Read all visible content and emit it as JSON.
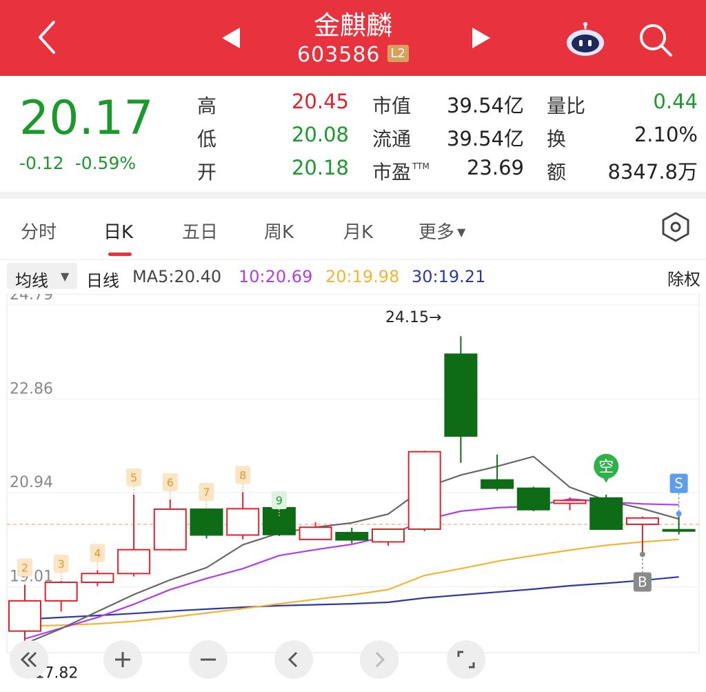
{
  "header": {
    "title": "金麒麟",
    "code": "603586",
    "level_badge": "L2",
    "bg_color": "#e8323e"
  },
  "quote": {
    "price": "20.17",
    "change": "-0.12",
    "change_pct": "-0.59%",
    "fields": [
      {
        "label": "高",
        "value": "20.45",
        "color": "red"
      },
      {
        "label": "低",
        "value": "20.08",
        "color": "green"
      },
      {
        "label": "开",
        "value": "20.18",
        "color": "green"
      },
      {
        "label": "市值",
        "value": "39.54亿",
        "color": "dark"
      },
      {
        "label": "流通",
        "value": "39.54亿",
        "color": "dark"
      },
      {
        "label": "市盈",
        "label_sup": "TTM",
        "value": "23.69",
        "color": "dark"
      },
      {
        "label": "量比",
        "value": "0.44",
        "color": "green"
      },
      {
        "label": "换",
        "value": "2.10%",
        "color": "dark"
      },
      {
        "label": "额",
        "value": "8347.8万",
        "color": "dark"
      }
    ]
  },
  "tabs": [
    "分时",
    "日K",
    "五日",
    "周K",
    "月K",
    "更多"
  ],
  "active_tab": "日K",
  "ma_bar": {
    "selector": "均线",
    "line_type": "日线",
    "ma5": "MA5:20.40",
    "ma10": "10:20.69",
    "ma20": "20:19.98",
    "ma30": "30:19.21",
    "adjust": "除权",
    "colors": {
      "ma5": "#666666",
      "ma10": "#b03cf0",
      "ma20": "#f3b431",
      "ma30": "#2e37a8"
    }
  },
  "chart_data": {
    "type": "candlestick",
    "y_ticks": [
      "24.79",
      "22.86",
      "20.94",
      "19.01"
    ],
    "y_tick_values": [
      24.79,
      22.86,
      20.94,
      19.01
    ],
    "high_label": "24.15→",
    "low_label": "←17.82",
    "up_color": "#e4202a",
    "down_color": "#0e6b16",
    "reference_price": 20.29,
    "candles": [
      {
        "o": 18.1,
        "h": 19.05,
        "l": 17.82,
        "c": 18.72
      },
      {
        "o": 18.72,
        "h": 19.13,
        "l": 18.5,
        "c": 19.1
      },
      {
        "o": 19.1,
        "h": 19.35,
        "l": 19.02,
        "c": 19.28
      },
      {
        "o": 19.28,
        "h": 20.9,
        "l": 19.22,
        "c": 19.77
      },
      {
        "o": 19.77,
        "h": 20.8,
        "l": 19.75,
        "c": 20.6
      },
      {
        "o": 20.6,
        "h": 20.6,
        "l": 20.0,
        "c": 20.07
      },
      {
        "o": 20.07,
        "h": 20.95,
        "l": 19.98,
        "c": 20.61
      },
      {
        "o": 20.63,
        "h": 20.43,
        "l": 20.05,
        "c": 20.08
      },
      {
        "o": 19.98,
        "h": 20.33,
        "l": 19.98,
        "c": 20.23
      },
      {
        "o": 20.12,
        "h": 20.22,
        "l": 19.9,
        "c": 19.97
      },
      {
        "o": 19.93,
        "h": 20.2,
        "l": 19.85,
        "c": 20.19
      },
      {
        "o": 20.19,
        "h": 21.8,
        "l": 20.15,
        "c": 21.78
      },
      {
        "o": 23.78,
        "h": 24.15,
        "l": 21.55,
        "c": 22.1
      },
      {
        "o": 21.2,
        "h": 21.72,
        "l": 20.98,
        "c": 21.03
      },
      {
        "o": 21.03,
        "h": 21.06,
        "l": 20.56,
        "c": 20.59
      },
      {
        "o": 20.72,
        "h": 20.84,
        "l": 20.58,
        "c": 20.78
      },
      {
        "o": 20.83,
        "h": 20.9,
        "l": 20.19,
        "c": 20.19
      },
      {
        "o": 20.29,
        "h": 20.45,
        "l": 19.73,
        "c": 20.42
      },
      {
        "o": 20.18,
        "h": 20.45,
        "l": 20.08,
        "c": 20.17
      }
    ],
    "ma5": [
      17.84,
      18.15,
      18.5,
      18.85,
      19.15,
      19.4,
      19.87,
      20.11,
      20.23,
      20.32,
      20.5,
      21.04,
      21.3,
      21.48,
      21.68,
      21.05,
      20.78,
      20.61,
      20.4
    ],
    "ma10": [
      17.94,
      18.16,
      18.38,
      18.65,
      18.95,
      19.18,
      19.38,
      19.65,
      19.77,
      19.88,
      20.05,
      20.38,
      20.56,
      20.63,
      20.66,
      20.81,
      20.75,
      20.71,
      20.69
    ],
    "ma20": [
      18.2,
      18.22,
      18.25,
      18.3,
      18.38,
      18.47,
      18.56,
      18.66,
      18.75,
      18.84,
      18.95,
      19.24,
      19.38,
      19.53,
      19.65,
      19.76,
      19.86,
      19.93,
      19.98
    ],
    "ma30": [
      18.34,
      18.38,
      18.42,
      18.46,
      18.51,
      18.55,
      18.59,
      18.62,
      18.64,
      18.66,
      18.69,
      18.78,
      18.84,
      18.9,
      18.96,
      19.03,
      19.08,
      19.14,
      19.21
    ],
    "day_markers": [
      {
        "i": 0,
        "label": "2"
      },
      {
        "i": 1,
        "label": "3"
      },
      {
        "i": 2,
        "label": "4"
      },
      {
        "i": 3,
        "label": "5"
      },
      {
        "i": 4,
        "label": "6"
      },
      {
        "i": 5,
        "label": "7"
      },
      {
        "i": 6,
        "label": "8"
      },
      {
        "i": 7,
        "label": "9"
      }
    ],
    "signals": [
      {
        "i": 16,
        "label": "空"
      },
      {
        "i": 17,
        "label": "B"
      },
      {
        "i": 18,
        "label": "S"
      }
    ]
  }
}
